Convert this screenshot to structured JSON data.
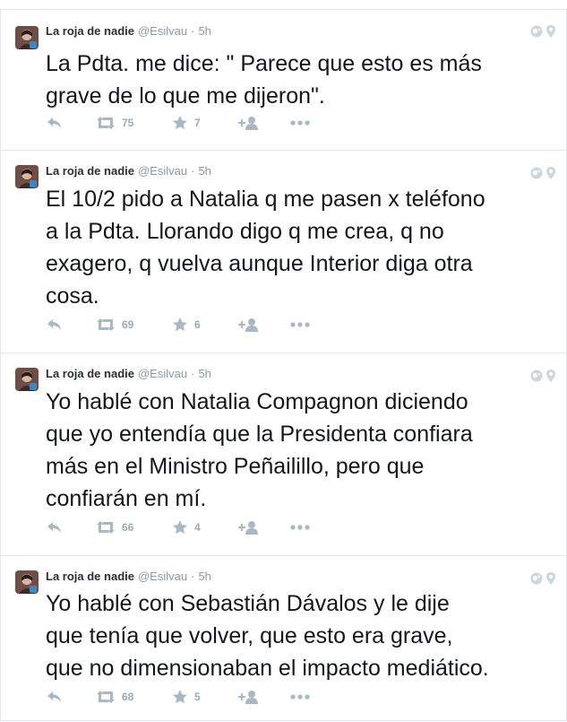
{
  "colors": {
    "icon": "#aab8c2",
    "border": "#e1e8ed",
    "meta": "#8899a6",
    "text": "#14171a"
  },
  "icons": {
    "reply": "reply-icon",
    "retweet": "retweet-icon",
    "favorite": "star-icon",
    "follow": "follow-icon",
    "more": "more-icon",
    "globe": "globe-icon",
    "location": "location-pin-icon"
  },
  "tweets": [
    {
      "name": "La roja de nadie",
      "handle": "@Esilvau",
      "separator": "·",
      "time": "5h",
      "text": "La Pdta. me dice: \" Parece que esto es más\ngrave de lo que me dijeron\".",
      "retweets": "75",
      "favorites": "7"
    },
    {
      "name": "La roja de nadie",
      "handle": "@Esilvau",
      "separator": "·",
      "time": "5h",
      "text": "El 10/2 pido a Natalia q me pasen x teléfono\na la Pdta. Llorando digo q me crea, q no\nexagero, q vuelva aunque Interior diga otra\ncosa.",
      "retweets": "69",
      "favorites": "6"
    },
    {
      "name": "La roja de nadie",
      "handle": "@Esilvau",
      "separator": "·",
      "time": "5h",
      "text": "Yo hablé con Natalia Compagnon diciendo\nque yo entendía que la Presidenta confiara\nmás en el Ministro Peñailillo, pero que\nconfiarán en mí.",
      "retweets": "66",
      "favorites": "4"
    },
    {
      "name": "La roja de nadie",
      "handle": "@Esilvau",
      "separator": "·",
      "time": "5h",
      "text": "Yo hablé con Sebastián Dávalos y le dije\nque tenía que volver, que esto era grave,\nque no dimensionaban el impacto mediático.",
      "retweets": "68",
      "favorites": "5"
    }
  ]
}
